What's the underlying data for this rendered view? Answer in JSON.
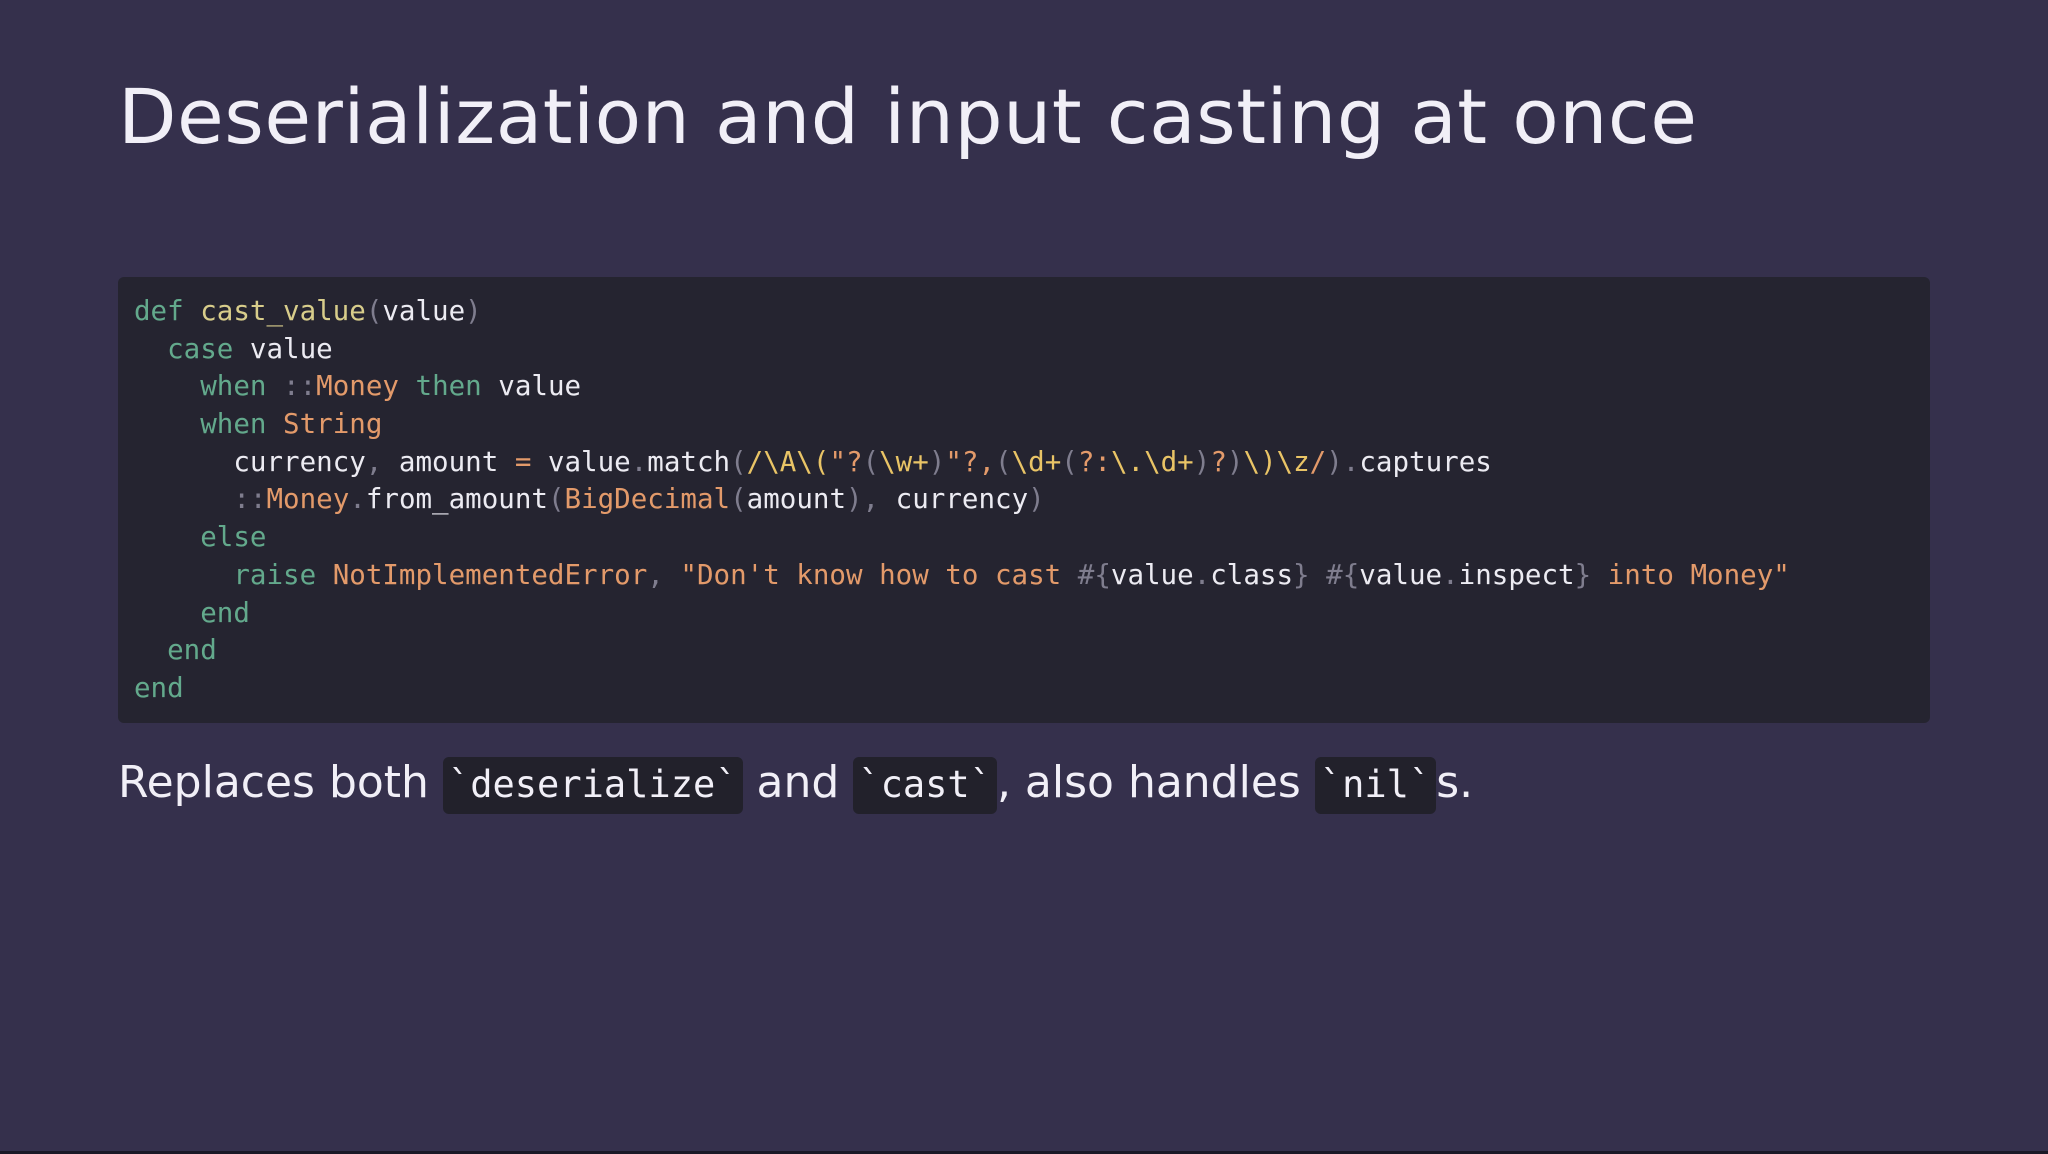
{
  "slide": {
    "title": "Deserialization and input casting at once"
  },
  "code": {
    "language": "ruby",
    "lines": [
      [
        [
          "kw",
          "def"
        ],
        [
          "id",
          " "
        ],
        [
          "fn",
          "cast_value"
        ],
        [
          "pn",
          "("
        ],
        [
          "id",
          "value"
        ],
        [
          "pn",
          ")"
        ]
      ],
      [
        [
          "id",
          "  "
        ],
        [
          "kw",
          "case"
        ],
        [
          "id",
          " value"
        ]
      ],
      [
        [
          "id",
          "    "
        ],
        [
          "kw",
          "when"
        ],
        [
          "id",
          " "
        ],
        [
          "pn",
          "::"
        ],
        [
          "cn",
          "Money"
        ],
        [
          "id",
          " "
        ],
        [
          "kw",
          "then"
        ],
        [
          "id",
          " value"
        ]
      ],
      [
        [
          "id",
          "    "
        ],
        [
          "kw",
          "when"
        ],
        [
          "id",
          " "
        ],
        [
          "cn",
          "String"
        ]
      ],
      [
        [
          "id",
          "      currency"
        ],
        [
          "pn",
          ","
        ],
        [
          "id",
          " amount "
        ],
        [
          "cn",
          "="
        ],
        [
          "id",
          " value"
        ],
        [
          "pn",
          "."
        ],
        [
          "id",
          "match"
        ],
        [
          "pn",
          "("
        ],
        [
          "re",
          "/\\A\\("
        ],
        [
          "st",
          "\"?"
        ],
        [
          "pn",
          "("
        ],
        [
          "re",
          "\\w+"
        ],
        [
          "pn",
          ")"
        ],
        [
          "st",
          "\"?,"
        ],
        [
          "pn",
          "("
        ],
        [
          "re",
          "\\d+"
        ],
        [
          "pn",
          "("
        ],
        [
          "st",
          "?:"
        ],
        [
          "re",
          "\\.\\d+"
        ],
        [
          "pn",
          ")"
        ],
        [
          "st",
          "?"
        ],
        [
          "pn",
          ")"
        ],
        [
          "re",
          "\\)\\z"
        ],
        [
          "st",
          "/"
        ],
        [
          "pn",
          ")."
        ],
        [
          "id",
          "captures"
        ]
      ],
      [
        [
          "id",
          "      "
        ],
        [
          "pn",
          "::"
        ],
        [
          "cn",
          "Money"
        ],
        [
          "pn",
          "."
        ],
        [
          "id",
          "from_amount"
        ],
        [
          "pn",
          "("
        ],
        [
          "cn",
          "BigDecimal"
        ],
        [
          "pn",
          "("
        ],
        [
          "id",
          "amount"
        ],
        [
          "pn",
          "),"
        ],
        [
          "id",
          " currency"
        ],
        [
          "pn",
          ")"
        ]
      ],
      [
        [
          "id",
          "    "
        ],
        [
          "kw",
          "else"
        ]
      ],
      [
        [
          "id",
          "      "
        ],
        [
          "kw",
          "raise"
        ],
        [
          "id",
          " "
        ],
        [
          "cn",
          "NotImplementedError"
        ],
        [
          "pn",
          ","
        ],
        [
          "id",
          " "
        ],
        [
          "st",
          "\"Don't know how to cast "
        ],
        [
          "pn",
          "#{"
        ],
        [
          "id",
          "value"
        ],
        [
          "pn",
          "."
        ],
        [
          "id",
          "class"
        ],
        [
          "pn",
          "}"
        ],
        [
          "st",
          " "
        ],
        [
          "pn",
          "#{"
        ],
        [
          "id",
          "value"
        ],
        [
          "pn",
          "."
        ],
        [
          "id",
          "inspect"
        ],
        [
          "pn",
          "}"
        ],
        [
          "st",
          " into Money\""
        ]
      ],
      [
        [
          "id",
          "    "
        ],
        [
          "kw",
          "end"
        ]
      ],
      [
        [
          "id",
          "  "
        ],
        [
          "kw",
          "end"
        ]
      ],
      [
        [
          "kw",
          "end"
        ]
      ]
    ]
  },
  "caption": {
    "text_before": "Replaces both ",
    "code_1": "`deserialize`",
    "text_middle": " and ",
    "code_2": "`cast`",
    "text_after_2": ", also handles ",
    "code_3": "`nil`",
    "text_end": "s."
  },
  "colors": {
    "background": "#35304c",
    "code_background": "#252430",
    "keyword": "#63a98c",
    "function": "#d8cd8b",
    "constant": "#e39a6a",
    "regex": "#e9c466",
    "punctuation": "#7f7d8e"
  }
}
